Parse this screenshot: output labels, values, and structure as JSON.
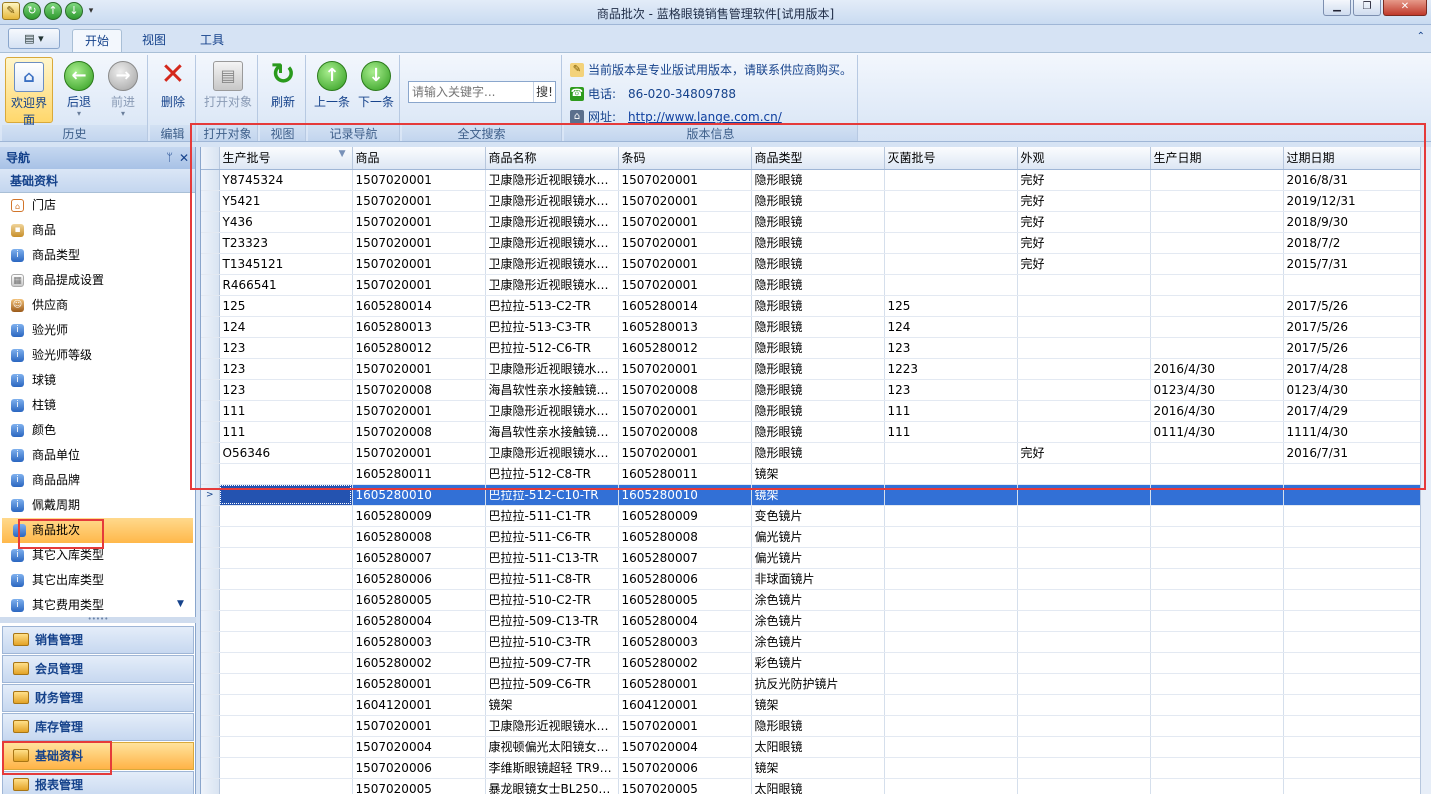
{
  "window": {
    "title": "商品批次 - 蓝格眼镜销售管理软件[试用版本]"
  },
  "menu_tabs": [
    "开始",
    "视图",
    "工具"
  ],
  "ribbon": {
    "groups": {
      "history": "历史",
      "edit": "编辑",
      "open": "打开对象",
      "view": "视图",
      "record_nav": "记录导航",
      "fulltext": "全文搜索",
      "version": "版本信息"
    },
    "buttons": {
      "welcome": "欢迎界面",
      "back": "后退",
      "forward": "前进",
      "delete": "删除",
      "open_object": "打开对象",
      "refresh": "刷新",
      "prev": "上一条",
      "next": "下一条"
    },
    "search": {
      "placeholder": "请输入关键字...",
      "button": "搜!"
    },
    "version_info": {
      "notice": "当前版本是专业版试用版本，请联系供应商购买。",
      "phone_label": "电话:",
      "phone": "86-020-34809788",
      "site_label": "网址:",
      "site": "http://www.lange.com.cn/"
    }
  },
  "nav": {
    "title": "导航",
    "section": "基础资料",
    "items": [
      {
        "label": "门店",
        "icon": "home-icon"
      },
      {
        "label": "商品",
        "icon": "box-icon"
      },
      {
        "label": "商品类型",
        "icon": "info-icon"
      },
      {
        "label": "商品提成设置",
        "icon": "table-icon"
      },
      {
        "label": "供应商",
        "icon": "people-icon"
      },
      {
        "label": "验光师",
        "icon": "info-icon"
      },
      {
        "label": "验光师等级",
        "icon": "info-icon"
      },
      {
        "label": "球镜",
        "icon": "info-icon"
      },
      {
        "label": "柱镜",
        "icon": "info-icon"
      },
      {
        "label": "颜色",
        "icon": "info-icon"
      },
      {
        "label": "商品单位",
        "icon": "info-icon"
      },
      {
        "label": "商品品牌",
        "icon": "info-icon"
      },
      {
        "label": "佩戴周期",
        "icon": "info-icon"
      },
      {
        "label": "商品批次",
        "icon": "info-icon"
      },
      {
        "label": "其它入库类型",
        "icon": "info-icon"
      },
      {
        "label": "其它出库类型",
        "icon": "info-icon"
      },
      {
        "label": "其它费用类型",
        "icon": "info-icon"
      }
    ],
    "selected_item": "商品批次",
    "outlook_bars": [
      "销售管理",
      "会员管理",
      "财务管理",
      "库存管理",
      "基础资料",
      "报表管理"
    ],
    "selected_bar": "基础资料"
  },
  "grid": {
    "columns": [
      "生产批号",
      "商品",
      "商品名称",
      "条码",
      "商品类型",
      "灭菌批号",
      "外观",
      "生产日期",
      "过期日期"
    ],
    "rows": [
      [
        "Y8745324",
        "1507020001",
        "卫康隐形近视眼镜水…",
        "1507020001",
        "隐形眼镜",
        "",
        "完好",
        "",
        "2016/8/31"
      ],
      [
        "Y5421",
        "1507020001",
        "卫康隐形近视眼镜水…",
        "1507020001",
        "隐形眼镜",
        "",
        "完好",
        "",
        "2019/12/31"
      ],
      [
        "Y436",
        "1507020001",
        "卫康隐形近视眼镜水…",
        "1507020001",
        "隐形眼镜",
        "",
        "完好",
        "",
        "2018/9/30"
      ],
      [
        "T23323",
        "1507020001",
        "卫康隐形近视眼镜水…",
        "1507020001",
        "隐形眼镜",
        "",
        "完好",
        "",
        "2018/7/2"
      ],
      [
        "T1345121",
        "1507020001",
        "卫康隐形近视眼镜水…",
        "1507020001",
        "隐形眼镜",
        "",
        "完好",
        "",
        "2015/7/31"
      ],
      [
        "R466541",
        "1507020001",
        "卫康隐形近视眼镜水…",
        "1507020001",
        "隐形眼镜",
        "",
        "",
        "",
        ""
      ],
      [
        "125",
        "1605280014",
        "巴拉拉-513-C2-TR",
        "1605280014",
        "隐形眼镜",
        "125",
        "",
        "",
        "2017/5/26"
      ],
      [
        "124",
        "1605280013",
        "巴拉拉-513-C3-TR",
        "1605280013",
        "隐形眼镜",
        "124",
        "",
        "",
        "2017/5/26"
      ],
      [
        "123",
        "1605280012",
        "巴拉拉-512-C6-TR",
        "1605280012",
        "隐形眼镜",
        "123",
        "",
        "",
        "2017/5/26"
      ],
      [
        "123",
        "1507020001",
        "卫康隐形近视眼镜水…",
        "1507020001",
        "隐形眼镜",
        "1223",
        "",
        "2016/4/30",
        "2017/4/28"
      ],
      [
        "123",
        "1507020008",
        "海昌软性亲水接触镜…",
        "1507020008",
        "隐形眼镜",
        "123",
        "",
        "0123/4/30",
        "0123/4/30"
      ],
      [
        "111",
        "1507020001",
        "卫康隐形近视眼镜水…",
        "1507020001",
        "隐形眼镜",
        "111",
        "",
        "2016/4/30",
        "2017/4/29"
      ],
      [
        "111",
        "1507020008",
        "海昌软性亲水接触镜…",
        "1507020008",
        "隐形眼镜",
        "111",
        "",
        "0111/4/30",
        "1111/4/30"
      ],
      [
        " O56346",
        "1507020001",
        "卫康隐形近视眼镜水…",
        "1507020001",
        "隐形眼镜",
        "",
        "完好",
        "",
        "2016/7/31"
      ],
      [
        "",
        "1605280011",
        "巴拉拉-512-C8-TR",
        "1605280011",
        "镜架",
        "",
        "",
        "",
        ""
      ],
      [
        "",
        "1605280010",
        "巴拉拉-512-C10-TR",
        "1605280010",
        "镜架",
        "",
        "",
        "",
        ""
      ],
      [
        "",
        "1605280009",
        "巴拉拉-511-C1-TR",
        "1605280009",
        "变色镜片",
        "",
        "",
        "",
        ""
      ],
      [
        "",
        "1605280008",
        "巴拉拉-511-C6-TR",
        "1605280008",
        "偏光镜片",
        "",
        "",
        "",
        ""
      ],
      [
        "",
        "1605280007",
        "巴拉拉-511-C13-TR",
        "1605280007",
        "偏光镜片",
        "",
        "",
        "",
        ""
      ],
      [
        "",
        "1605280006",
        "巴拉拉-511-C8-TR",
        "1605280006",
        "非球面镜片",
        "",
        "",
        "",
        ""
      ],
      [
        "",
        "1605280005",
        "巴拉拉-510-C2-TR",
        "1605280005",
        "涂色镜片",
        "",
        "",
        "",
        ""
      ],
      [
        "",
        "1605280004",
        "巴拉拉-509-C13-TR",
        "1605280004",
        "涂色镜片",
        "",
        "",
        "",
        ""
      ],
      [
        "",
        "1605280003",
        "巴拉拉-510-C3-TR",
        "1605280003",
        "涂色镜片",
        "",
        "",
        "",
        ""
      ],
      [
        "",
        "1605280002",
        "巴拉拉-509-C7-TR",
        "1605280002",
        "彩色镜片",
        "",
        "",
        "",
        ""
      ],
      [
        "",
        "1605280001",
        "巴拉拉-509-C6-TR",
        "1605280001",
        "抗反光防护镜片",
        "",
        "",
        "",
        ""
      ],
      [
        "",
        "1604120001",
        "镜架",
        "1604120001",
        "镜架",
        "",
        "",
        "",
        ""
      ],
      [
        "",
        "1507020001",
        "卫康隐形近视眼镜水…",
        "1507020001",
        "隐形眼镜",
        "",
        "",
        "",
        ""
      ],
      [
        "",
        "1507020004",
        "康视顿偏光太阳镜女…",
        "1507020004",
        "太阳眼镜",
        "",
        "",
        "",
        ""
      ],
      [
        "",
        "1507020006",
        "李维斯眼镜超轻 TR90…",
        "1507020006",
        "镜架",
        "",
        "",
        "",
        ""
      ],
      [
        "",
        "1507020005",
        "暴龙眼镜女士BL2502…",
        "1507020005",
        "太阳眼镜",
        "",
        "",
        "",
        ""
      ]
    ],
    "selected_row_index": 15,
    "row_indicator": ">"
  },
  "colors": {
    "selection": "#3270d6",
    "highlight_box": "#e53a3a",
    "nav_selected": "#ffb84a"
  }
}
